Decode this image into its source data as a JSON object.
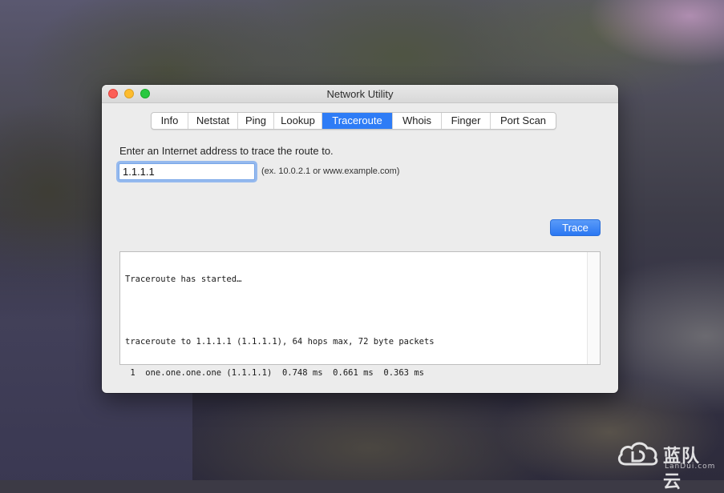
{
  "window": {
    "title": "Network Utility"
  },
  "tabs": [
    {
      "label": "Info"
    },
    {
      "label": "Netstat"
    },
    {
      "label": "Ping"
    },
    {
      "label": "Lookup"
    },
    {
      "label": "Traceroute",
      "selected": true
    },
    {
      "label": "Whois"
    },
    {
      "label": "Finger"
    },
    {
      "label": "Port Scan"
    }
  ],
  "traceroute": {
    "prompt": "Enter an Internet address to trace the route to.",
    "address_value": "1.1.1.1",
    "hint": "(ex. 10.0.2.1 or www.example.com)",
    "trace_button": "Trace",
    "output_lines": [
      "Traceroute has started…",
      "",
      "traceroute to 1.1.1.1 (1.1.1.1), 64 hops max, 72 byte packets",
      " 1  one.one.one.one (1.1.1.1)  0.748 ms  0.661 ms  0.363 ms"
    ]
  },
  "watermark": {
    "text": "蓝队云",
    "sub": "LanDui.com"
  },
  "colors": {
    "accent": "#2e7cf6",
    "close": "#fc5f57",
    "minimize": "#fdbc2e",
    "maximize": "#28c840"
  }
}
